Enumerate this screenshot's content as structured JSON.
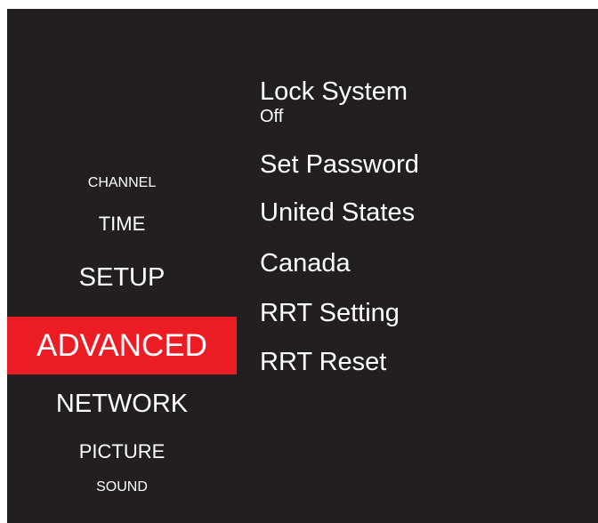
{
  "colors": {
    "background": "#231f20",
    "selected_highlight": "#ec1c24",
    "text": "#ffffff"
  },
  "categories": [
    {
      "label": "CHANNEL",
      "selected": false
    },
    {
      "label": "TIME",
      "selected": false
    },
    {
      "label": "SETUP",
      "selected": false
    },
    {
      "label": "ADVANCED",
      "selected": true
    },
    {
      "label": "NETWORK",
      "selected": false
    },
    {
      "label": "PICTURE",
      "selected": false
    },
    {
      "label": "SOUND",
      "selected": false
    }
  ],
  "options": [
    {
      "label": "Lock System",
      "value": "Off"
    },
    {
      "label": "Set Password"
    },
    {
      "label": "United States"
    },
    {
      "label": "Canada"
    },
    {
      "label": "RRT Setting"
    },
    {
      "label": "RRT Reset"
    }
  ]
}
